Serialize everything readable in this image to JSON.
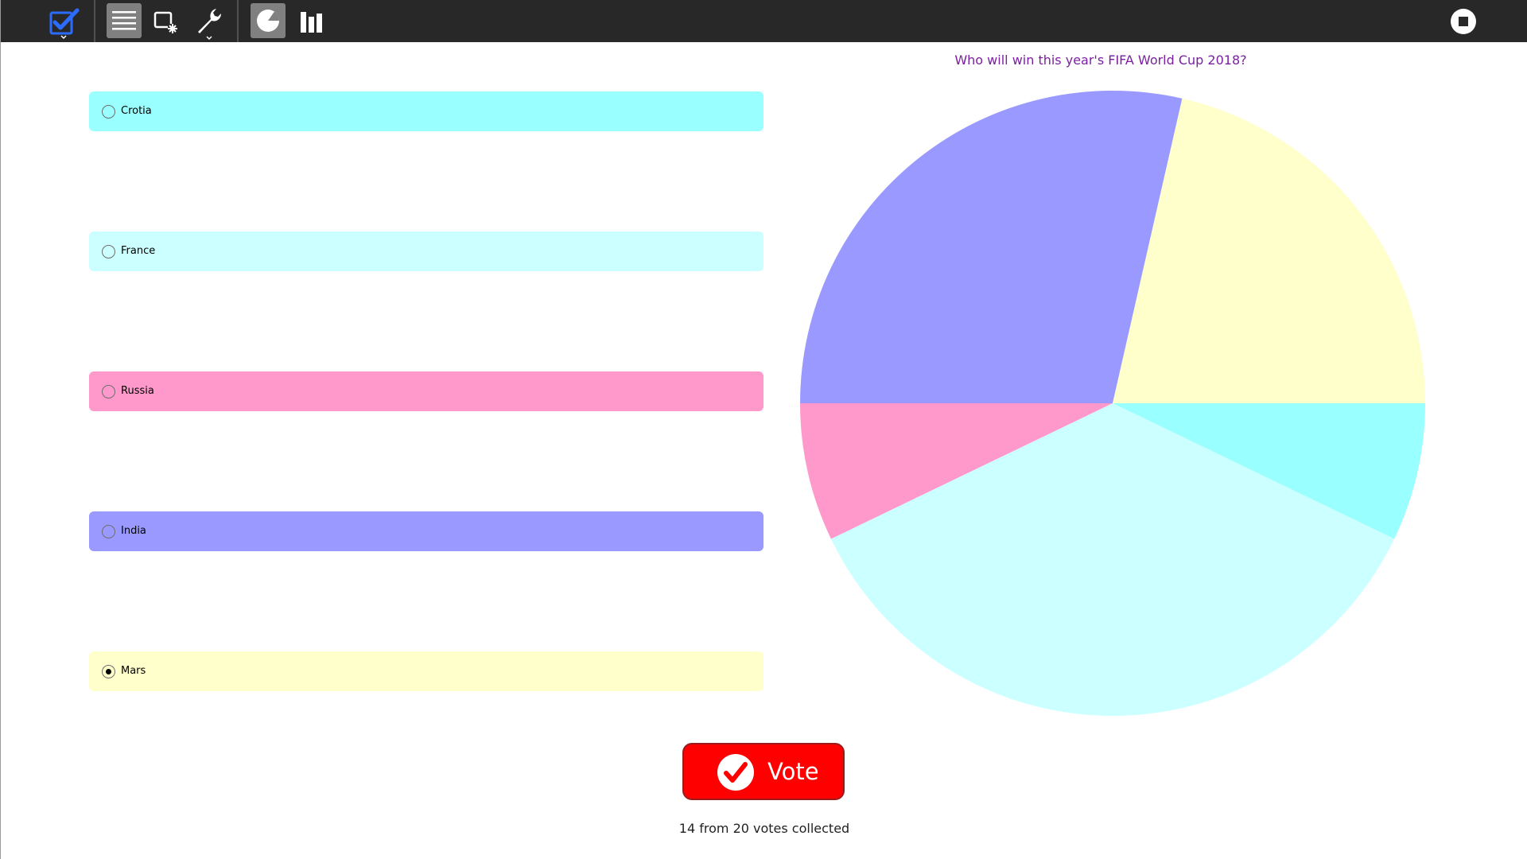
{
  "toolbar": {
    "buttons": [
      {
        "name": "poll-checkbox-icon",
        "color": "#2b6cff"
      },
      {
        "name": "menu-icon"
      },
      {
        "name": "screen-select-icon"
      },
      {
        "name": "wrench-icon"
      },
      {
        "name": "pie-chart-view-icon",
        "active": true
      },
      {
        "name": "bar-chart-view-icon"
      },
      {
        "name": "stop-icon"
      }
    ]
  },
  "poll": {
    "question": "Who will win this year's FIFA World Cup 2018?",
    "options": [
      {
        "label": "Crotia",
        "color": "#99ffff",
        "selected": false
      },
      {
        "label": "France",
        "color": "#ccffff",
        "selected": false
      },
      {
        "label": "Russia",
        "color": "#ff99cc",
        "selected": false
      },
      {
        "label": "India",
        "color": "#9999ff",
        "selected": false
      },
      {
        "label": "Mars",
        "color": "#ffffcc",
        "selected": true
      }
    ],
    "vote_label": "Vote",
    "status": "14 from 20 votes collected"
  },
  "chart_data": {
    "type": "pie",
    "title": "Who will win this year's FIFA World Cup 2018?",
    "categories": [
      "Crotia",
      "France",
      "Russia",
      "India",
      "Mars"
    ],
    "values": [
      1,
      5,
      1,
      4,
      3
    ],
    "colors": [
      "#99ffff",
      "#ccffff",
      "#ff99cc",
      "#9999ff",
      "#ffffcc"
    ],
    "total_votes": 14
  }
}
